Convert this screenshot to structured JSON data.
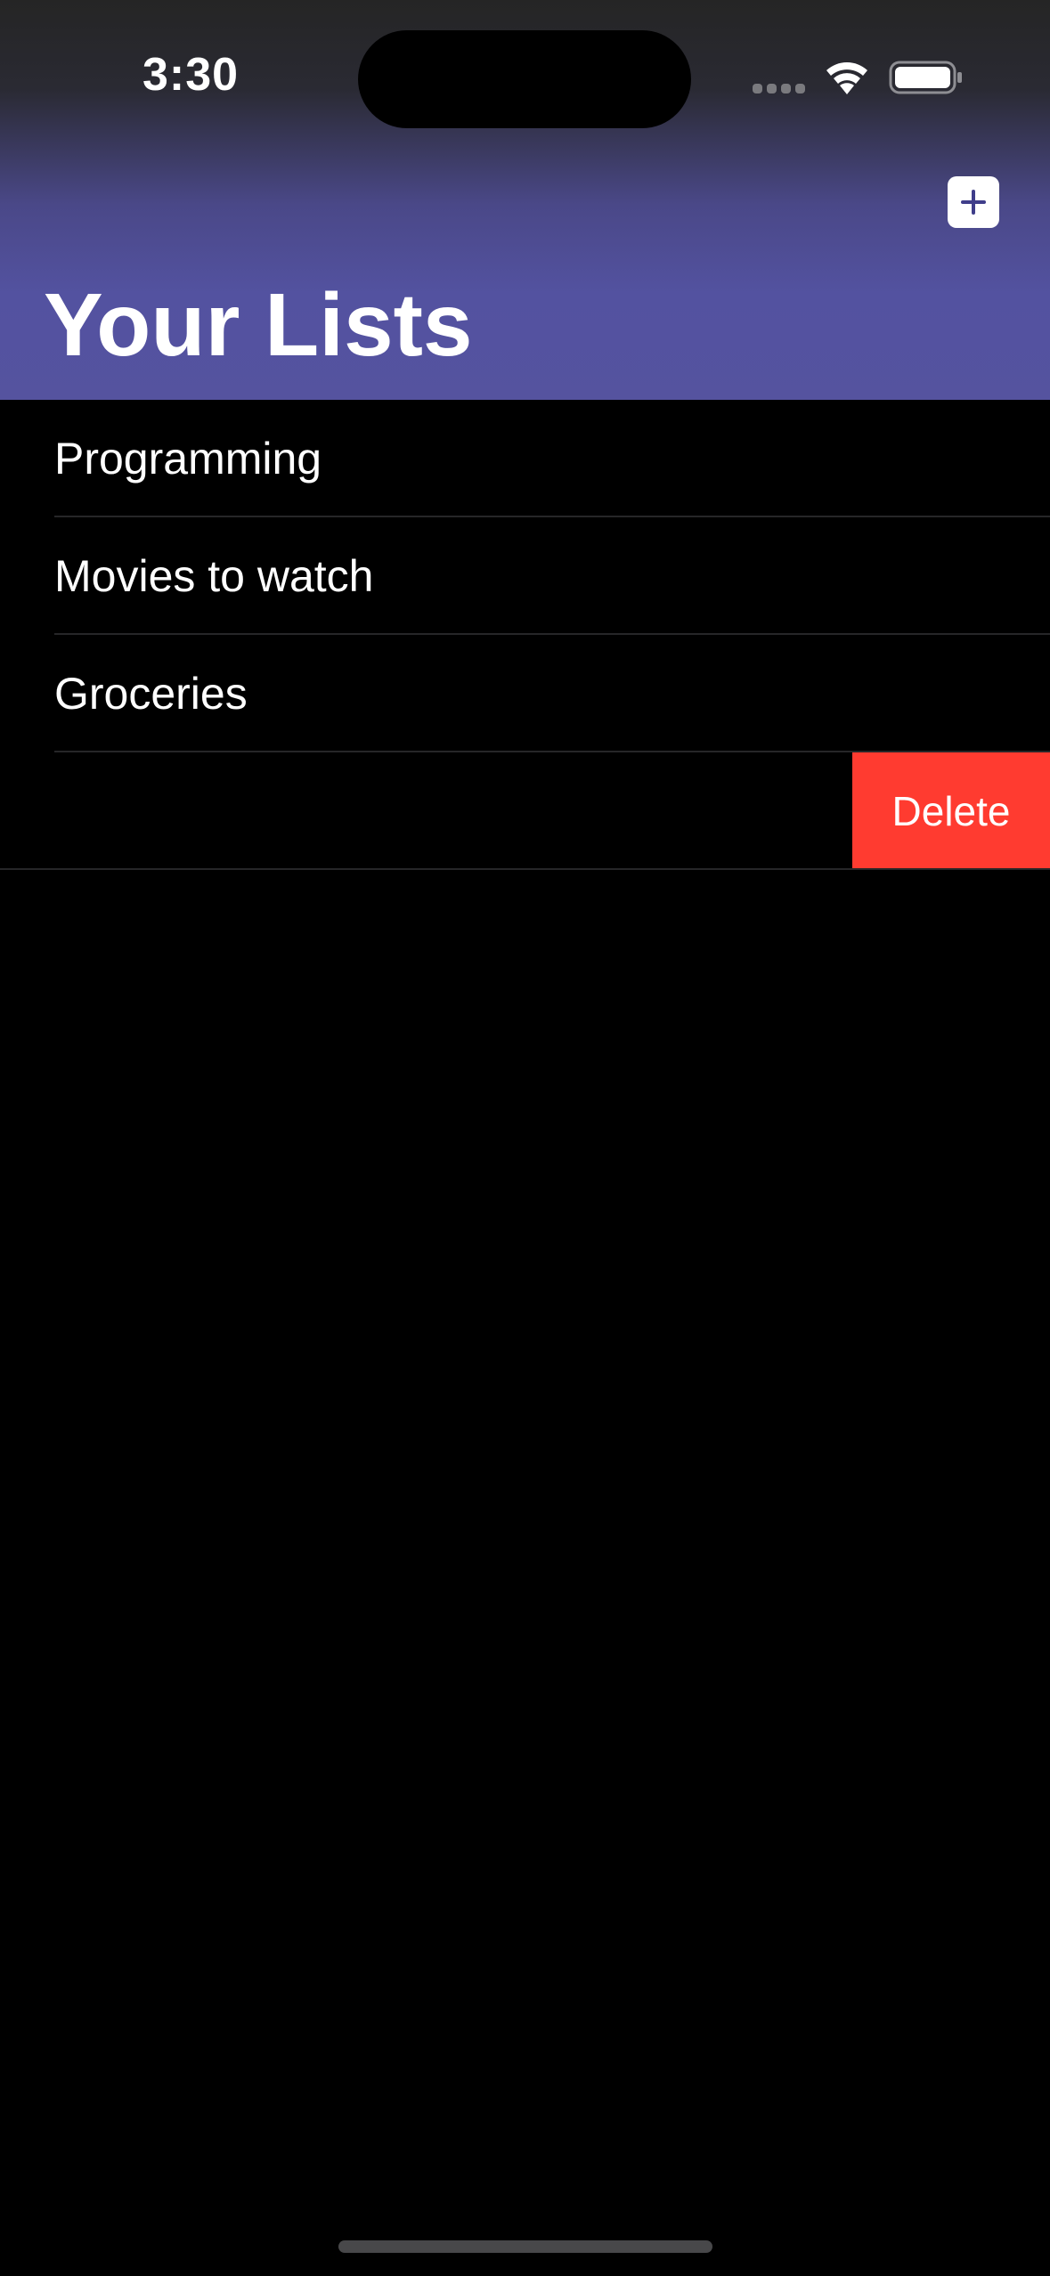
{
  "status_bar": {
    "time": "3:30",
    "icons": [
      "cellular-signal-icon",
      "wifi-icon",
      "battery-icon"
    ]
  },
  "nav": {
    "title": "Your Lists",
    "add_icon": "plus-icon"
  },
  "lists": [
    {
      "name": "Programming"
    },
    {
      "name": "Movies to watch"
    },
    {
      "name": "Groceries"
    }
  ],
  "swiped_row": {
    "delete_label": "Delete"
  },
  "colors": {
    "header_accent": "#5352a0",
    "delete": "#ff3b30",
    "background": "#000000"
  }
}
